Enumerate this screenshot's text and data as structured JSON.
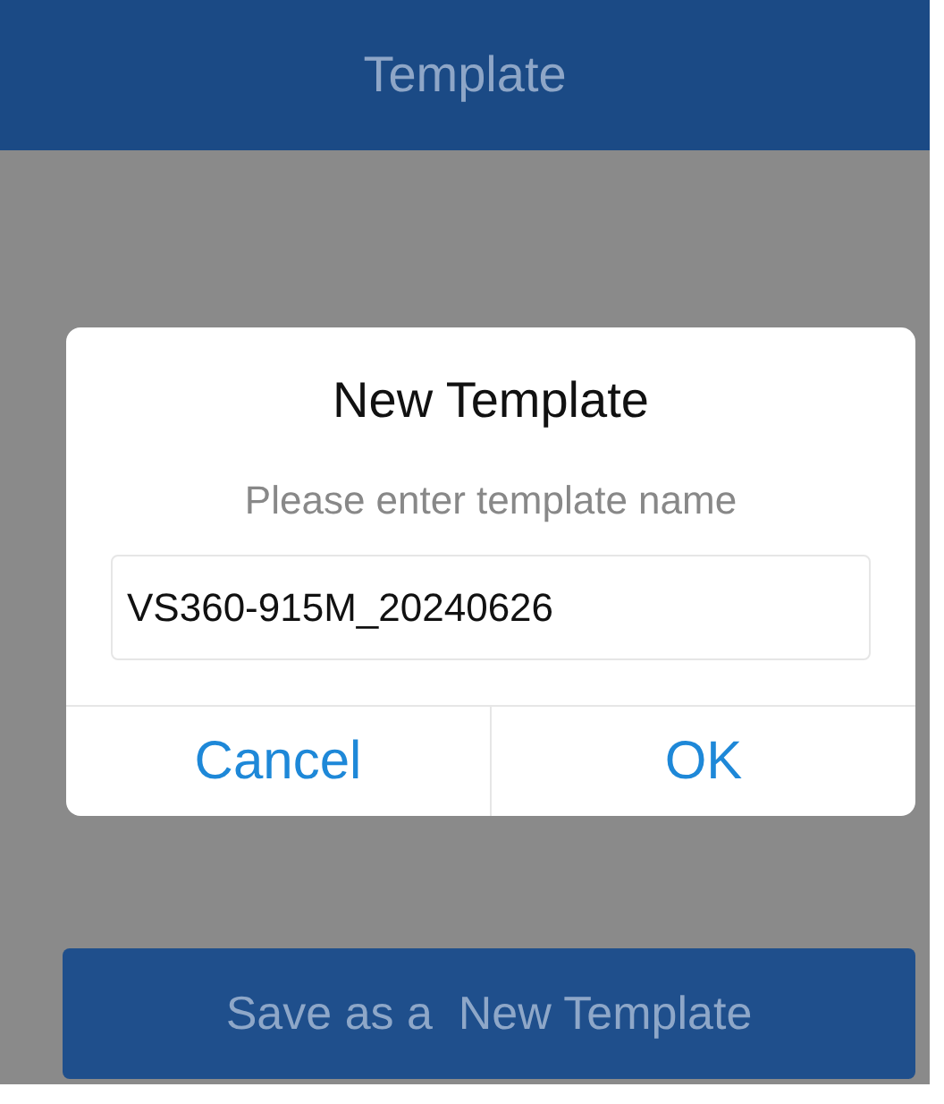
{
  "header": {
    "title": "Template"
  },
  "dialog": {
    "title": "New Template",
    "message": "Please enter template name",
    "input": {
      "value": "VS360-915M_20240626"
    },
    "buttons": [
      {
        "label": "Cancel"
      },
      {
        "label": "OK"
      }
    ]
  },
  "save_button": {
    "label": "Save as a  New Template"
  }
}
